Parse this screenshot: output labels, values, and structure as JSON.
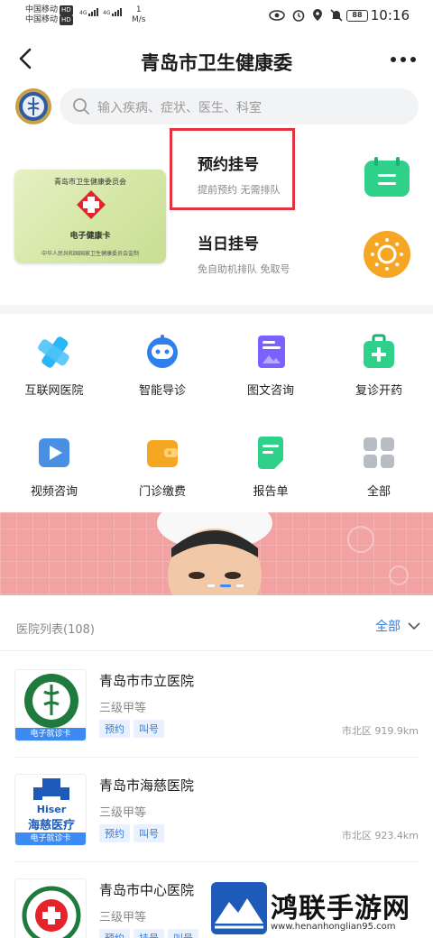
{
  "status_bar": {
    "carrier1": "中国移动",
    "carrier2": "中国移动",
    "hd": "HD",
    "speed_value": "1",
    "speed_unit": "M/s",
    "battery": "88",
    "time": "10:16"
  },
  "nav": {
    "title": "青岛市卫生健康委"
  },
  "search": {
    "placeholder": "输入疾病、症状、医生、科室"
  },
  "health_card": {
    "issuer": "青岛市卫生健康委员会",
    "name": "电子健康卡",
    "footer": "中华人民共和国国家卫生健康委员会监制"
  },
  "services": {
    "appointment": {
      "title": "预约挂号",
      "subtitle": "提前预约 无需排队"
    },
    "same_day": {
      "title": "当日挂号",
      "subtitle": "免自助机排队 免取号"
    }
  },
  "grid": [
    {
      "label": "互联网医院",
      "icon": "cross-icon"
    },
    {
      "label": "智能导诊",
      "icon": "robot-icon"
    },
    {
      "label": "图文咨询",
      "icon": "image-doc-icon"
    },
    {
      "label": "复诊开药",
      "icon": "medkit-icon"
    },
    {
      "label": "视频咨询",
      "icon": "video-icon"
    },
    {
      "label": "门诊缴费",
      "icon": "wallet-icon"
    },
    {
      "label": "报告单",
      "icon": "report-icon"
    },
    {
      "label": "全部",
      "icon": "apps-icon"
    }
  ],
  "hospital_list": {
    "title": "医院列表(108)",
    "filter": "全部",
    "items": [
      {
        "name": "青岛市市立医院",
        "level": "三级甲等",
        "tags": [
          "预约",
          "叫号"
        ],
        "location": "市北区 919.9km",
        "card_tag": "电子就诊卡",
        "logo_text": ""
      },
      {
        "name": "青岛市海慈医院",
        "level": "三级甲等",
        "tags": [
          "预约",
          "叫号"
        ],
        "location": "市北区 923.4km",
        "card_tag": "电子就诊卡",
        "logo_text": "Hiser",
        "logo_text2": "海慈医疗"
      },
      {
        "name": "青岛市中心医院",
        "level": "三级甲等",
        "tags": [
          "预约",
          "挂号",
          "叫号"
        ],
        "location": "",
        "card_tag": "",
        "logo_text": ""
      }
    ]
  },
  "watermark": {
    "text": "鸿联手游网",
    "url": "www.henanhonglian95.com"
  },
  "colors": {
    "accent": "#2a7ee8",
    "highlight": "#e0353f",
    "green": "#2fd08a",
    "orange": "#f5a623"
  }
}
